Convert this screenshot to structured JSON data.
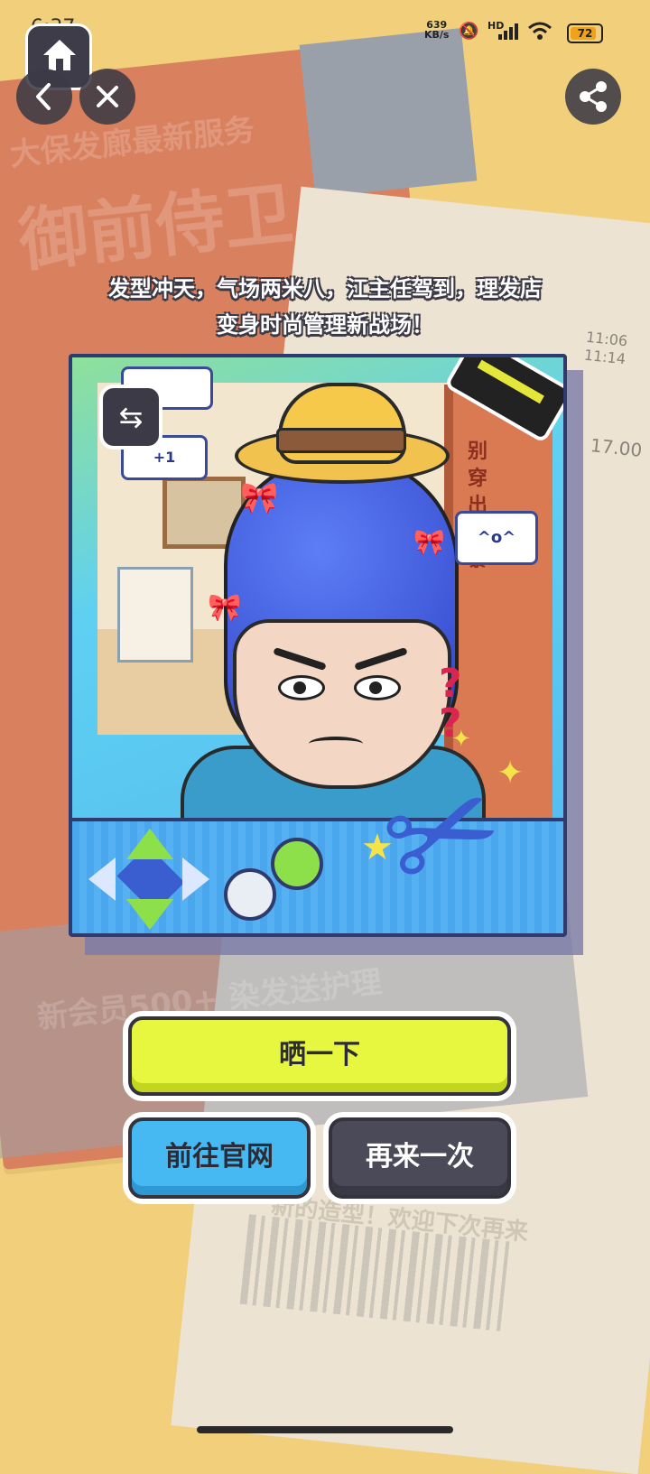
{
  "status_bar": {
    "time": "6:37",
    "net_speed": "639",
    "net_unit": "KB/s",
    "battery": "72",
    "signal_label": "HD"
  },
  "nav": {
    "home_icon": "home-icon",
    "back_icon": "chevron-left-icon",
    "close_icon": "close-icon",
    "share_icon": "share-icon"
  },
  "background": {
    "poster_line1": "大保发廊最新服务",
    "poster_title": "御前侍卫",
    "bottom_text": "新会员500+ 染发送护理",
    "receipt_footer": "新的造型！欢迎下次再来",
    "receipt_time1": "11:06",
    "receipt_time2": "11:14",
    "receipt_price": "17.00"
  },
  "caption": {
    "line1": "发型冲天，气场两米八，江主任驾到，理发店",
    "line2": "变身时尚管理新战场！"
  },
  "photo": {
    "speech_text": "^o^",
    "sticker_text": "+1",
    "door_text": "别穿出城暴"
  },
  "buttons": {
    "share_label": "晒一下",
    "site_label": "前往官网",
    "again_label": "再来一次"
  },
  "colors": {
    "background": "#f2cf7a",
    "primary_button": "#e7f73f",
    "site_button": "#47b9f2",
    "again_button": "#4b4a58"
  }
}
